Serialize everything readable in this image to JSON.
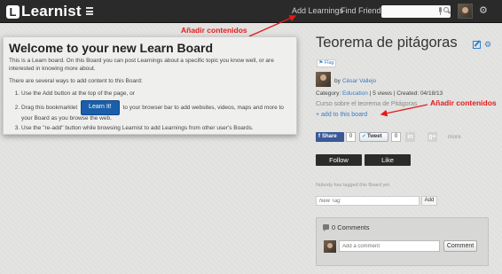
{
  "topbar": {
    "logo_mark": "L",
    "logo_text": "Learnist",
    "add_learnings": "Add Learnings",
    "find_friends": "Find Friends",
    "gear_glyph": "⚙"
  },
  "annotations": {
    "top": "Añadir contenidos",
    "right": "Añadir contenidos",
    "color": "#e31b1b"
  },
  "welcome": {
    "title": "Welcome to your new Learn Board",
    "intro": "This is a Learn board. On this Board you can post Learnings about a specific topic you know well, or are interested in knowing more about.",
    "ways_intro": "There are several ways to add content to this Board:",
    "step1": "Use the Add button at the top of the page, or",
    "step2_pre": "Drag this bookmarklet",
    "learn_it": "Learn It!",
    "step2_post": "to your browser bar to add websites, videos, maps and more to your Board as you browse the web.",
    "step3": "Use the \"re-add\" button while browsing Learnist to add Learnings from other user's Boards."
  },
  "board": {
    "title": "Teorema de pitágoras",
    "settings_glyph": "⚙",
    "flag": "⚑ Flag",
    "by": "by",
    "author": "César Vallejo",
    "category_label": "Category:",
    "category": "Education",
    "stats": "| 5 views | Created: 04/18/13",
    "description": "Curso sobre el teorema de Pitágoras",
    "add_link": "+ add to this board"
  },
  "share": {
    "fb_f": "f",
    "fb_label": "Share",
    "fb_count": "0",
    "tw_bird": "✔",
    "tw_label": "Tweet",
    "tw_count": "0",
    "in_label": "in",
    "gplus_label": "g+",
    "more": "more"
  },
  "actions": {
    "follow": "Follow",
    "like": "Like"
  },
  "tags": {
    "nobody_tagged": "Nobody has tagged this Board yet.",
    "placeholder": "New Tag",
    "add": "Add"
  },
  "comments": {
    "count_label": "0 Comments",
    "placeholder": "Add a comment",
    "button": "Comment"
  },
  "colors": {
    "accent": "#3a7cc1",
    "topbar": "#2a2a2a",
    "learn_it": "#1b5fab",
    "facebook": "#3b5998"
  }
}
